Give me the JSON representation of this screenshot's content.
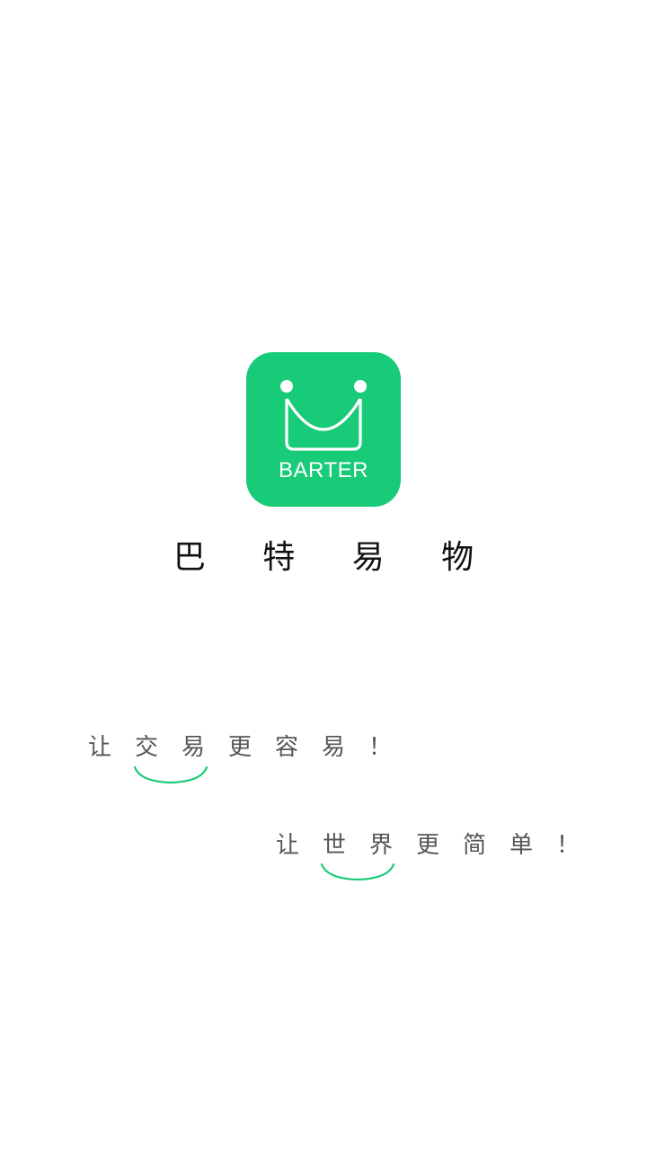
{
  "logo": {
    "word": "BARTER",
    "icon": "shopping-bag-smile-icon",
    "color": "#18cb78"
  },
  "app_name": "巴 特 易 物",
  "slogans": [
    {
      "chars": [
        "让",
        "交",
        "易",
        "更",
        "容",
        "易",
        "！"
      ]
    },
    {
      "chars": [
        "让",
        "世",
        "界",
        "更",
        "简",
        "单",
        "！"
      ]
    }
  ],
  "accent_color": "#18cb78"
}
